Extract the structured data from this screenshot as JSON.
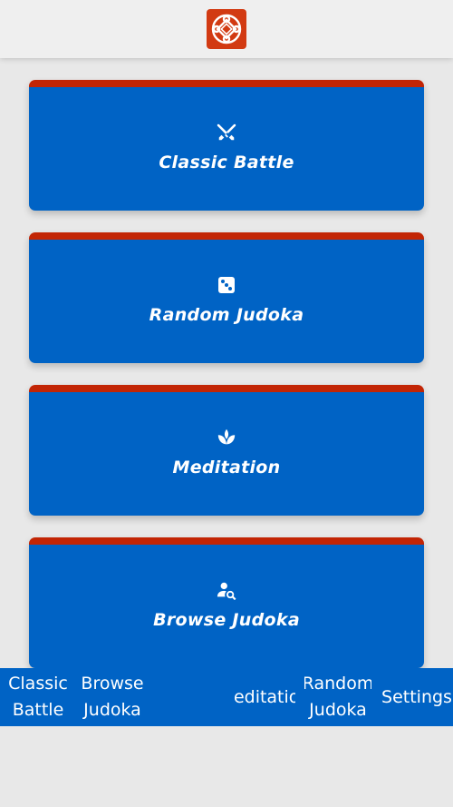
{
  "header": {
    "logo_icon": "knot-emblem-icon",
    "colors": {
      "logo_bg": "#d23a12",
      "header_bg": "#efefef"
    }
  },
  "cards": [
    {
      "label": "Classic Battle",
      "icon": "crossed-swords-icon"
    },
    {
      "label": "Random Judoka",
      "icon": "dice-icon"
    },
    {
      "label": "Meditation",
      "icon": "lotus-icon"
    },
    {
      "label": "Browse Judoka",
      "icon": "person-search-icon"
    }
  ],
  "bottom_nav": {
    "items": [
      {
        "label": "Classic\nBattle"
      },
      {
        "label": "Browse\nJudoka"
      },
      {
        "label": "Meditation"
      },
      {
        "label": "Random\nJudoka"
      },
      {
        "label": "Settings"
      }
    ]
  },
  "colors": {
    "card_bg": "#0063c5",
    "card_top_border": "#c22505",
    "nav_bg": "#0063c5",
    "page_bg": "#e8e8e8"
  }
}
